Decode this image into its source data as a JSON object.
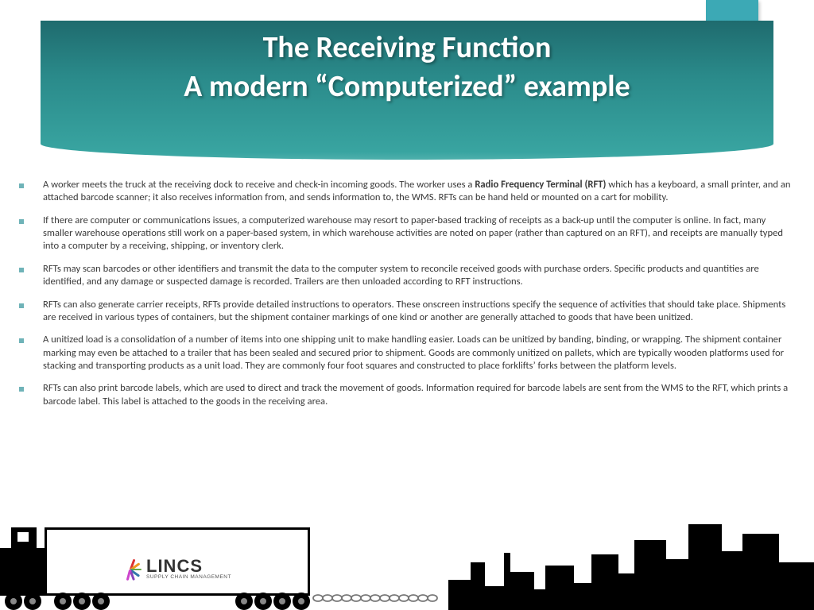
{
  "title_line1": "The Receiving Function",
  "title_line2": "A modern “Computerized” example",
  "bullets": [
    {
      "pre": "A worker meets the truck at the receiving dock to receive and check-in incoming goods. The worker uses a ",
      "bold": "Radio Frequency Terminal (RFT)",
      "post": " which has a keyboard, a small printer, and an attached barcode scanner; it also receives information from, and sends information to, the WMS. RFTs can be hand held or mounted on a cart for mobility."
    },
    {
      "pre": "If there are computer or communications issues, a computerized warehouse may resort to paper-based tracking of receipts as a back-up until the computer is online. In fact, many smaller warehouse operations still work on a paper-based system, in which warehouse activities are noted on paper (rather than captured on an RFT), and receipts are manually typed into a computer by a receiving, shipping, or inventory clerk.",
      "bold": "",
      "post": ""
    },
    {
      "pre": "RFTs may scan barcodes or other identifiers and transmit the data to the computer system to reconcile received goods with purchase orders. Specific products and quantities are identified, and any damage or suspected damage is recorded. Trailers are then unloaded according to RFT instructions.",
      "bold": "",
      "post": ""
    },
    {
      "pre": "RFTs can also generate carrier receipts, RFTs provide detailed instructions to operators. These onscreen instructions specify the sequence of activities that should take place. Shipments are received in various types of containers, but the  shipment container markings of one kind or another are generally attached to goods that have been unitized.",
      "bold": "",
      "post": ""
    },
    {
      "pre": "A  unitized load is a consolidation of a number of items into one shipping unit to make handling easier. Loads can be unitized by banding, binding, or wrapping. The shipment container marking may even be attached to a trailer that has been sealed and secured prior to shipment. Goods are commonly unitized on pallets, which are typically wooden platforms used for stacking and transporting products as a unit load. They are commonly four foot squares and constructed to place forklifts’ forks between the platform levels.",
      "bold": "",
      "post": ""
    },
    {
      "pre": "RFTs can also print barcode labels, which are used to direct and track the movement of goods. Information required for barcode labels are sent from the WMS to the RFT, which prints a barcode label. This label is attached to the goods in the receiving area.",
      "bold": "",
      "post": ""
    }
  ],
  "logo": {
    "main": "LINCS",
    "sub": "SUPPLY CHAIN MANAGEMENT"
  },
  "colors": {
    "banner_top": "#1f6b6e",
    "banner_bottom": "#3aa7a3",
    "tab": "#3ca9b5",
    "bullet": "#6fb3b8"
  }
}
